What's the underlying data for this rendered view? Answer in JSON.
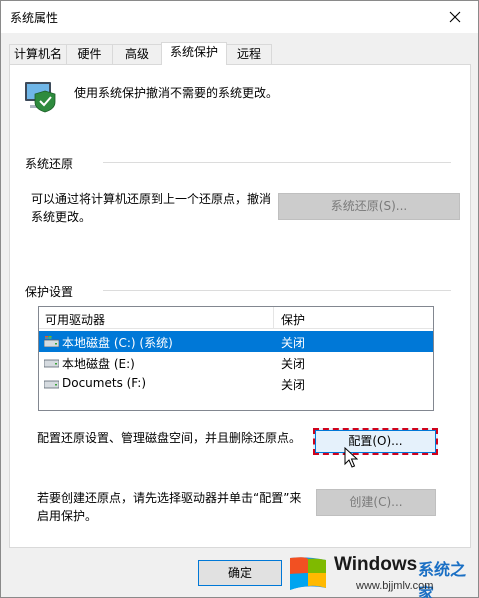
{
  "window": {
    "title": "系统属性"
  },
  "tabs": [
    {
      "label": "计算机名"
    },
    {
      "label": "硬件"
    },
    {
      "label": "高级"
    },
    {
      "label": "系统保护"
    },
    {
      "label": "远程"
    }
  ],
  "active_tab": "系统保护",
  "header": {
    "description": "使用系统保护撤消不需要的系统更改。",
    "icon": "computer-shield-icon"
  },
  "restore": {
    "group_label": "系统还原",
    "line1": "可以通过将计算机还原到上一个还原点，撤消",
    "line2": "系统更改。",
    "button_label": "系统还原(S)..."
  },
  "protection": {
    "group_label": "保护设置",
    "columns": [
      "可用驱动器",
      "保护"
    ],
    "drives": [
      {
        "name": "本地磁盘 (C:) (系统)",
        "status": "关闭",
        "icon": "system-drive-icon",
        "selected": true
      },
      {
        "name": "本地磁盘 (E:)",
        "status": "关闭",
        "icon": "drive-icon",
        "selected": false
      },
      {
        "name": "Documets (F:)",
        "status": "关闭",
        "icon": "drive-icon",
        "selected": false
      }
    ],
    "configure_text": "配置还原设置、管理磁盘空间，并且删除还原点。",
    "configure_button": "配置(O)...",
    "create_line1": "若要创建还原点，请先选择驱动器并单击“配置”来",
    "create_line2": "启用保护。",
    "create_button": "创建(C)..."
  },
  "footer": {
    "ok_label": "确定"
  },
  "watermark": {
    "brand": "Windows",
    "cn": "系统之家",
    "url": "www.bjjmlv.com"
  },
  "colors": {
    "selection": "#0078d7",
    "focus_dash": "#d0021b"
  }
}
